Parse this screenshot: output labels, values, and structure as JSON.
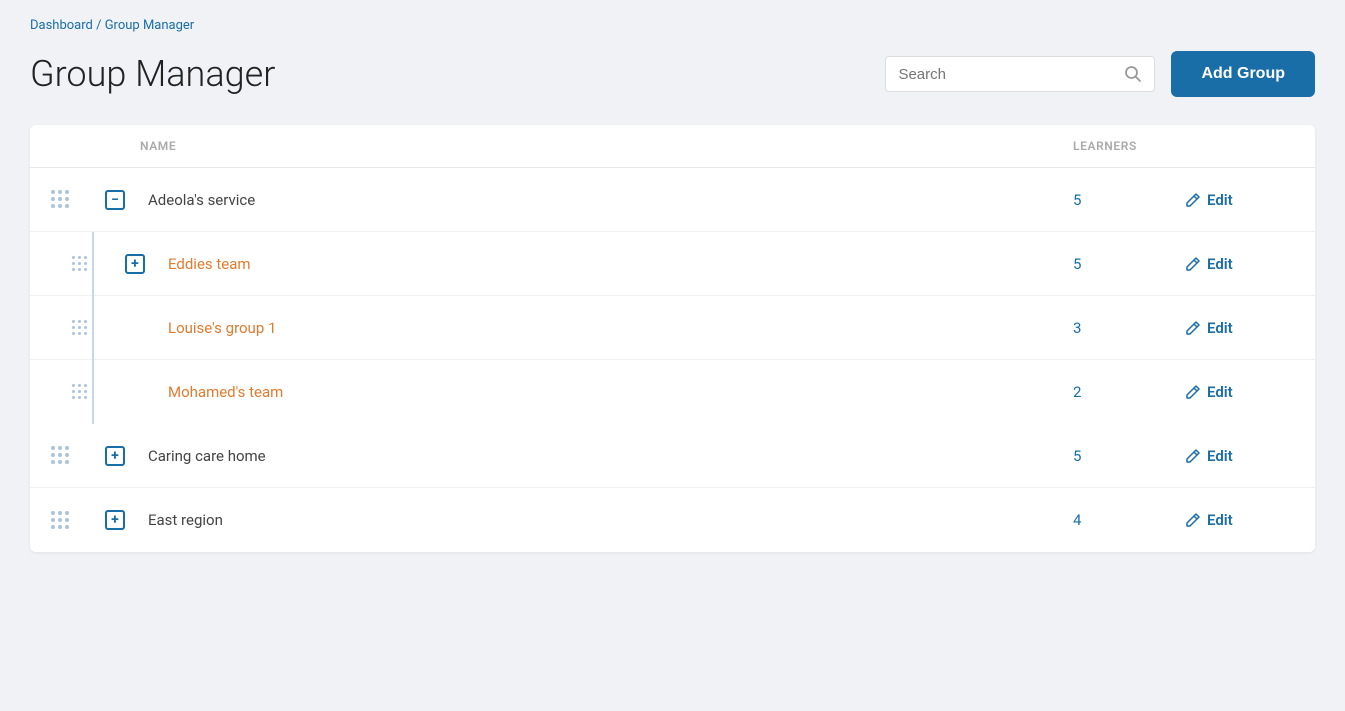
{
  "breadcrumb": {
    "dashboard": "Dashboard",
    "separator": " / ",
    "current": "Group Manager"
  },
  "page": {
    "title": "Group Manager"
  },
  "search": {
    "placeholder": "Search"
  },
  "buttons": {
    "add_group": "Add Group",
    "edit": "Edit"
  },
  "table": {
    "col_name": "NAME",
    "col_learners": "LEARNERS"
  },
  "groups": [
    {
      "id": "adeola",
      "name": "Adeola's service",
      "learners": 5,
      "expanded": true,
      "name_color": "normal",
      "subgroups": [
        {
          "id": "eddies",
          "name": "Eddies team",
          "learners": 5,
          "name_color": "orange"
        },
        {
          "id": "louise",
          "name": "Louise's group 1",
          "learners": 3,
          "name_color": "orange"
        },
        {
          "id": "mohamed",
          "name": "Mohamed's team",
          "learners": 2,
          "name_color": "orange"
        }
      ]
    },
    {
      "id": "caring",
      "name": "Caring care home",
      "learners": 5,
      "expanded": false,
      "name_color": "normal",
      "subgroups": []
    },
    {
      "id": "east",
      "name": "East region",
      "learners": 4,
      "expanded": false,
      "name_color": "normal",
      "subgroups": []
    }
  ]
}
